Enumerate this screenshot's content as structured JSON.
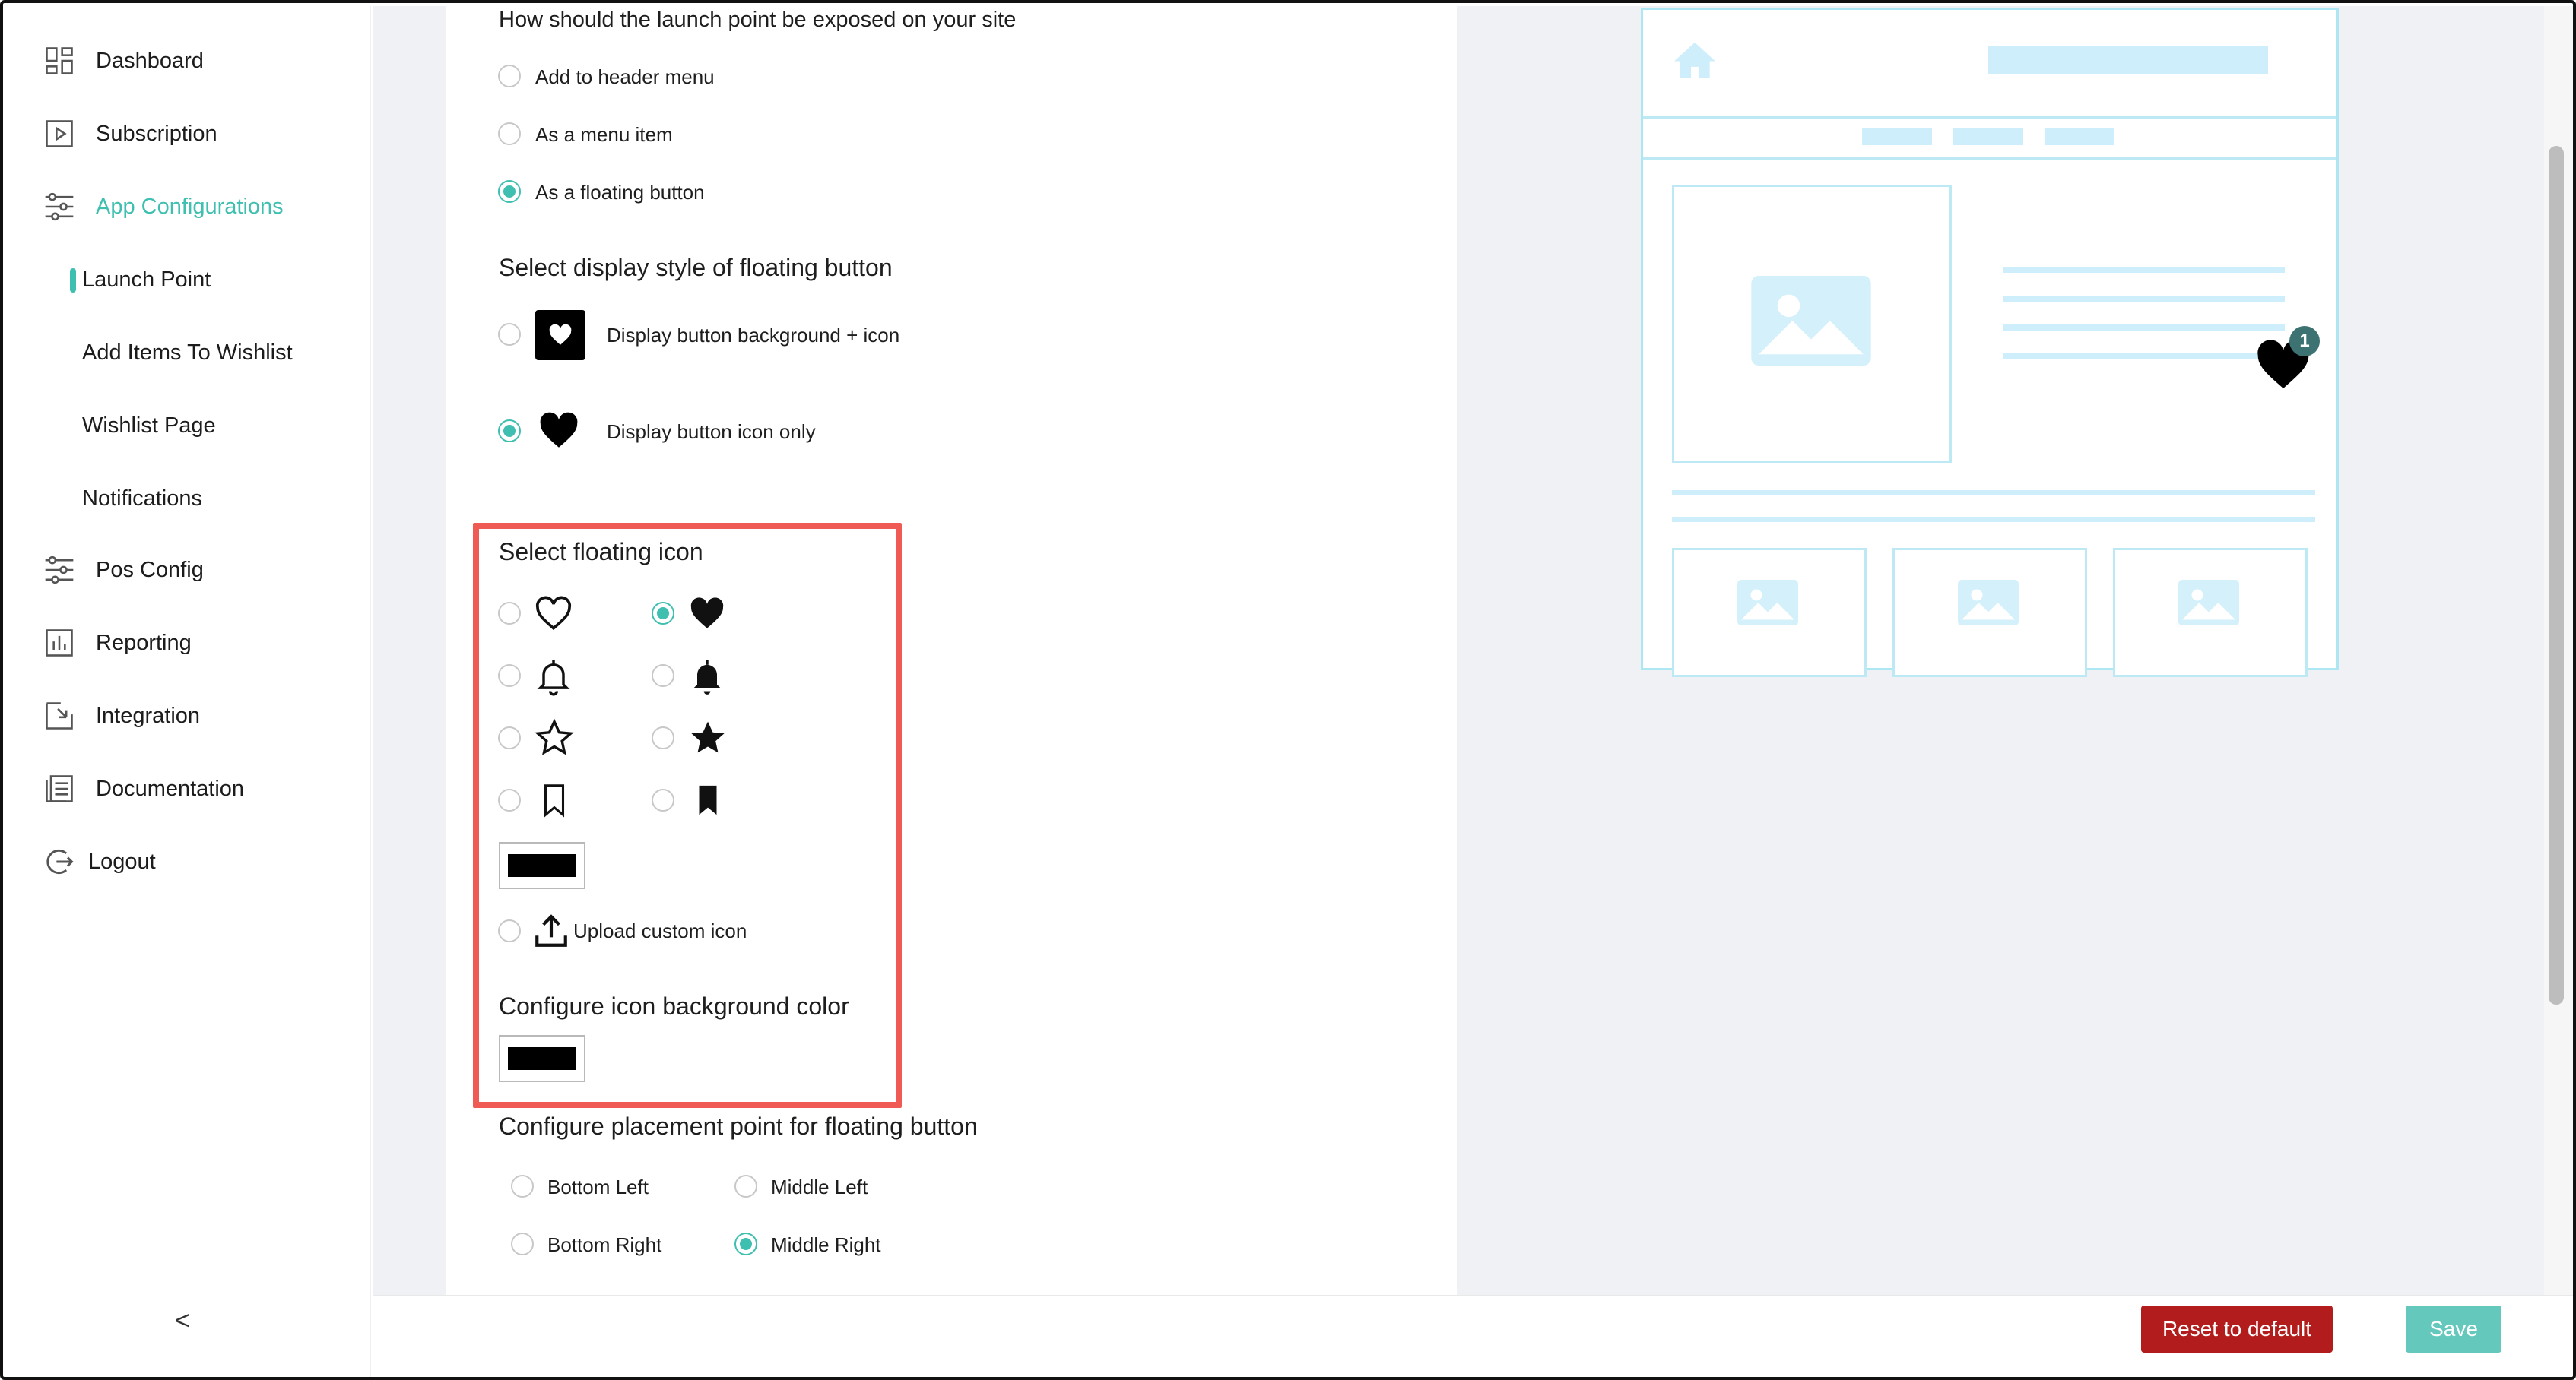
{
  "sidebar": {
    "items": [
      {
        "label": "Dashboard",
        "icon": "dashboard-icon"
      },
      {
        "label": "Subscription",
        "icon": "play-square-icon"
      },
      {
        "label": "App Configurations",
        "icon": "sliders-icon",
        "active": true
      },
      {
        "label": "Pos Config",
        "icon": "sliders-icon"
      },
      {
        "label": "Reporting",
        "icon": "bar-chart-icon"
      },
      {
        "label": "Integration",
        "icon": "import-icon"
      },
      {
        "label": "Documentation",
        "icon": "document-icon"
      },
      {
        "label": "Logout",
        "icon": "logout-icon"
      }
    ],
    "subitems": [
      {
        "label": "Launch Point",
        "active": true
      },
      {
        "label": "Add Items To Wishlist"
      },
      {
        "label": "Wishlist Page"
      },
      {
        "label": "Notifications"
      }
    ],
    "collapse_label": "<"
  },
  "launch": {
    "question": "How should the launch point be exposed on your site",
    "options": [
      {
        "label": "Add to header menu",
        "selected": false
      },
      {
        "label": "As a menu item",
        "selected": false
      },
      {
        "label": "As a floating button",
        "selected": true
      }
    ]
  },
  "display_style": {
    "title": "Select display style of floating button",
    "options": [
      {
        "label": "Display button background + icon",
        "selected": false
      },
      {
        "label": "Display button icon only",
        "selected": true
      }
    ]
  },
  "floating_icon": {
    "title": "Select floating icon",
    "icons": [
      {
        "name": "heart-outline-icon",
        "selected": false
      },
      {
        "name": "heart-filled-icon",
        "selected": true
      },
      {
        "name": "bell-outline-icon",
        "selected": false
      },
      {
        "name": "bell-filled-icon",
        "selected": false
      },
      {
        "name": "star-outline-icon",
        "selected": false
      },
      {
        "name": "star-filled-icon",
        "selected": false
      },
      {
        "name": "bookmark-outline-icon",
        "selected": false
      },
      {
        "name": "bookmark-filled-icon",
        "selected": false
      }
    ],
    "icon_color": "#000000",
    "upload_label": "Upload custom icon"
  },
  "icon_background": {
    "title": "Configure icon background color",
    "color": "#000000"
  },
  "placement": {
    "title": "Configure placement point for floating button",
    "options": [
      {
        "label": "Bottom Left",
        "selected": false
      },
      {
        "label": "Middle Left",
        "selected": false
      },
      {
        "label": "Bottom Right",
        "selected": false
      },
      {
        "label": "Middle Right",
        "selected": true
      }
    ]
  },
  "preview": {
    "badge_count": "1"
  },
  "footer": {
    "reset_label": "Reset to default",
    "save_label": "Save"
  },
  "colors": {
    "accent": "#3fbfb0",
    "reset": "#b31c1c",
    "save": "#65c8bd",
    "highlight": "#ef5b54",
    "preview_line": "#aee7f4"
  }
}
